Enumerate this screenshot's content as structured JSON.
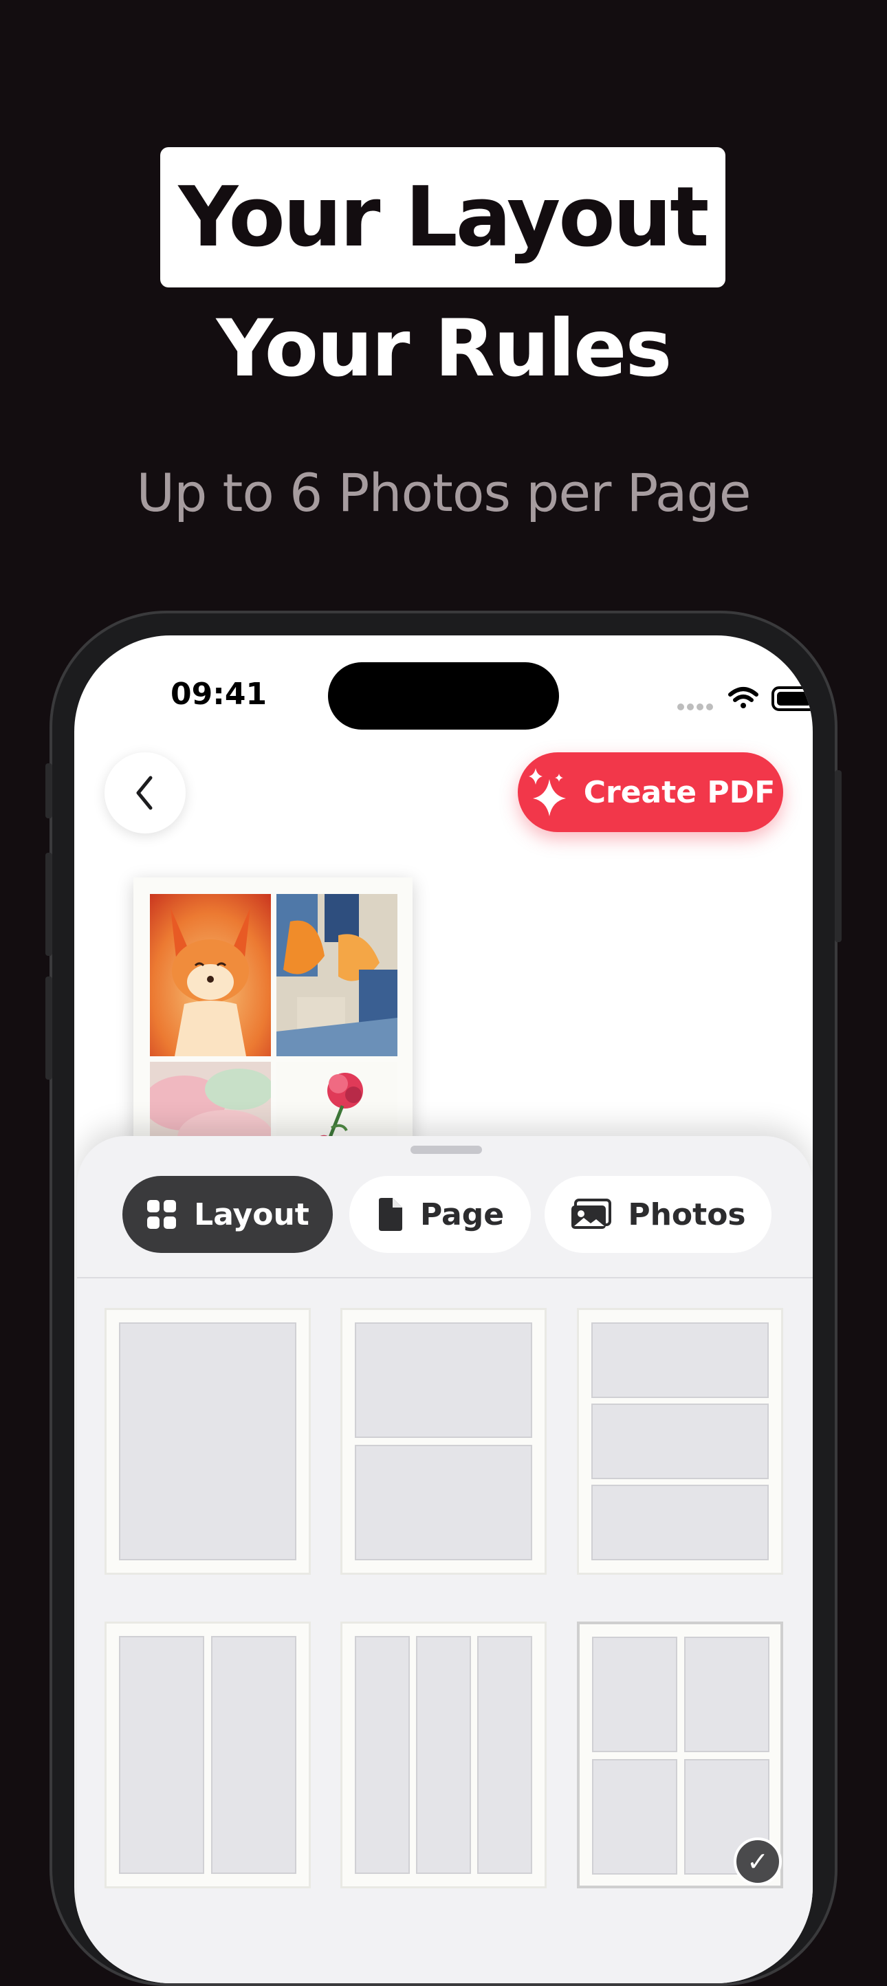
{
  "marketing": {
    "headline_line1": "Your Layout",
    "headline_line2": "Your Rules",
    "subheadline": "Up to 6 Photos per Page"
  },
  "status_bar": {
    "time": "09:41",
    "icons": [
      "signal-icon",
      "wifi-icon",
      "battery-icon"
    ]
  },
  "toolbar": {
    "back_icon": "chevron-left-icon",
    "create_pdf_label": "Create PDF",
    "create_pdf_icon": "sparkles-icon"
  },
  "preview": {
    "photos": [
      "fox-painting",
      "abstract-orange-blue-painting",
      "pastel-painting",
      "flower-painting"
    ]
  },
  "sheet": {
    "tabs": [
      {
        "label": "Layout",
        "icon": "grid-icon",
        "selected": true
      },
      {
        "label": "Page",
        "icon": "document-icon",
        "selected": false
      },
      {
        "label": "Photos",
        "icon": "photos-icon",
        "selected": false
      }
    ],
    "layouts": [
      {
        "name": "1 photo",
        "selected": false
      },
      {
        "name": "2 photos stacked",
        "selected": false
      },
      {
        "name": "3 photos stacked",
        "selected": false
      },
      {
        "name": "2 photos side by side",
        "selected": false
      },
      {
        "name": "3 photos side by side",
        "selected": false
      },
      {
        "name": "4 photos grid",
        "selected": true
      }
    ],
    "selected_check_icon": "checkmark-icon"
  },
  "colors": {
    "background": "#130d10",
    "accent": "#f2374a",
    "tab_selected": "#3a3a3c"
  }
}
